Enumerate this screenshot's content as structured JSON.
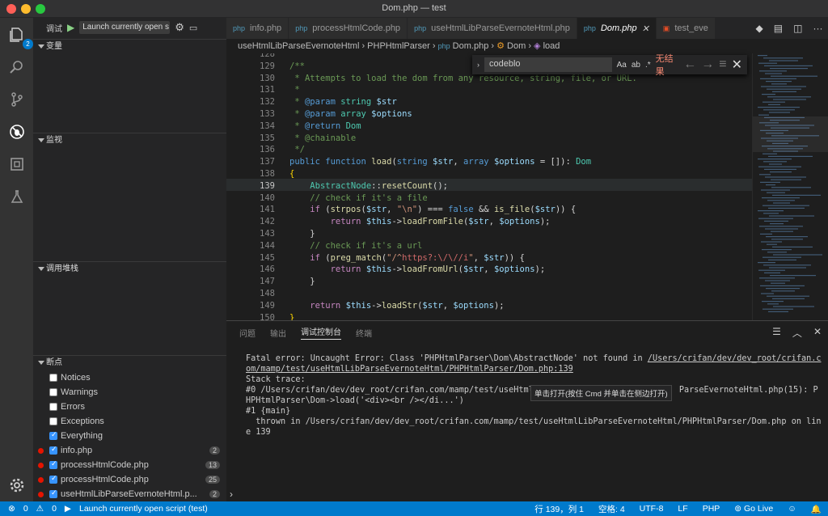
{
  "window": {
    "title": "Dom.php — test"
  },
  "activity": {
    "badge": "2"
  },
  "sidebar": {
    "debug_label": "调试",
    "config": "Launch currently open s",
    "sections": {
      "vars": "变量",
      "watch": "监视",
      "callstack": "调用堆栈",
      "breakpoints": "断点"
    },
    "breakpoints": [
      {
        "label": "Notices",
        "checked": false,
        "dot": false,
        "count": ""
      },
      {
        "label": "Warnings",
        "checked": false,
        "dot": false,
        "count": ""
      },
      {
        "label": "Errors",
        "checked": false,
        "dot": false,
        "count": ""
      },
      {
        "label": "Exceptions",
        "checked": false,
        "dot": false,
        "count": ""
      },
      {
        "label": "Everything",
        "checked": true,
        "dot": false,
        "count": ""
      },
      {
        "label": "info.php",
        "checked": true,
        "dot": true,
        "count": "2"
      },
      {
        "label": "processHtmlCode.php",
        "checked": true,
        "dot": true,
        "count": "13"
      },
      {
        "label": "processHtmlCode.php",
        "checked": true,
        "dot": true,
        "count": "25"
      },
      {
        "label": "useHtmlLibParseEvernoteHtml.p...",
        "checked": true,
        "dot": true,
        "count": "2"
      }
    ]
  },
  "tabs": [
    {
      "label": "info.php",
      "active": false
    },
    {
      "label": "processHtmlCode.php",
      "active": false
    },
    {
      "label": "useHtmlLibParseEvernoteHtml.php",
      "active": false
    },
    {
      "label": "Dom.php",
      "active": true
    },
    {
      "label": "test_eve",
      "active": false
    }
  ],
  "breadcrumb": {
    "p1": "useHtmlLibParseEvernoteHtml",
    "p2": "PHPHtmlParser",
    "p3": "Dom.php",
    "p4": "Dom",
    "p5": "load"
  },
  "find": {
    "query": "codeblo",
    "no_results": "无结果"
  },
  "editor": {
    "line_numbers": [
      "128",
      "129",
      "130",
      "131",
      "132",
      "133",
      "134",
      "135",
      "136",
      "137",
      "138",
      "139",
      "140",
      "141",
      "142",
      "143",
      "144",
      "145",
      "146",
      "147",
      "148",
      "149",
      "150"
    ],
    "current_line": "139"
  },
  "panel": {
    "tabs": [
      "问题",
      "输出",
      "调试控制台",
      "终端"
    ],
    "active_tab": "调试控制台",
    "output": {
      "l1a": "Fatal error: Uncaught Error: Class 'PHPHtmlParser\\Dom\\AbstractNode' not found in ",
      "l1link": "/Users/crifan/dev/dev_root/crifan.com/mamp/test/useHtmlLibParseEvernoteHtml/PHPHtmlParser/Dom.php:139",
      "l2": "Stack trace:",
      "l3a": "#0 /Users/crifan/dev/dev_root/crifan.com/mamp/test/useHtmlL",
      "l3b": "ParseEvernoteHtml.php(15): PHPHtmlParser\\Dom->load('<div><br /></di...')",
      "l4": "#1 {main}",
      "l5": "  thrown in /Users/crifan/dev/dev_root/crifan.com/mamp/test/useHtmlLibParseEvernoteHtml/PHPHtmlParser/Dom.php on line 139"
    },
    "tooltip": "单击打开(按住 Cmd 并单击在侧边打开)"
  },
  "status": {
    "errors": "0",
    "warnings": "0",
    "launch": "Launch currently open script (test)",
    "position": "行 139，列 1",
    "spaces": "空格: 4",
    "encoding": "UTF-8",
    "eol": "LF",
    "lang": "PHP",
    "golive": "Go Live"
  }
}
